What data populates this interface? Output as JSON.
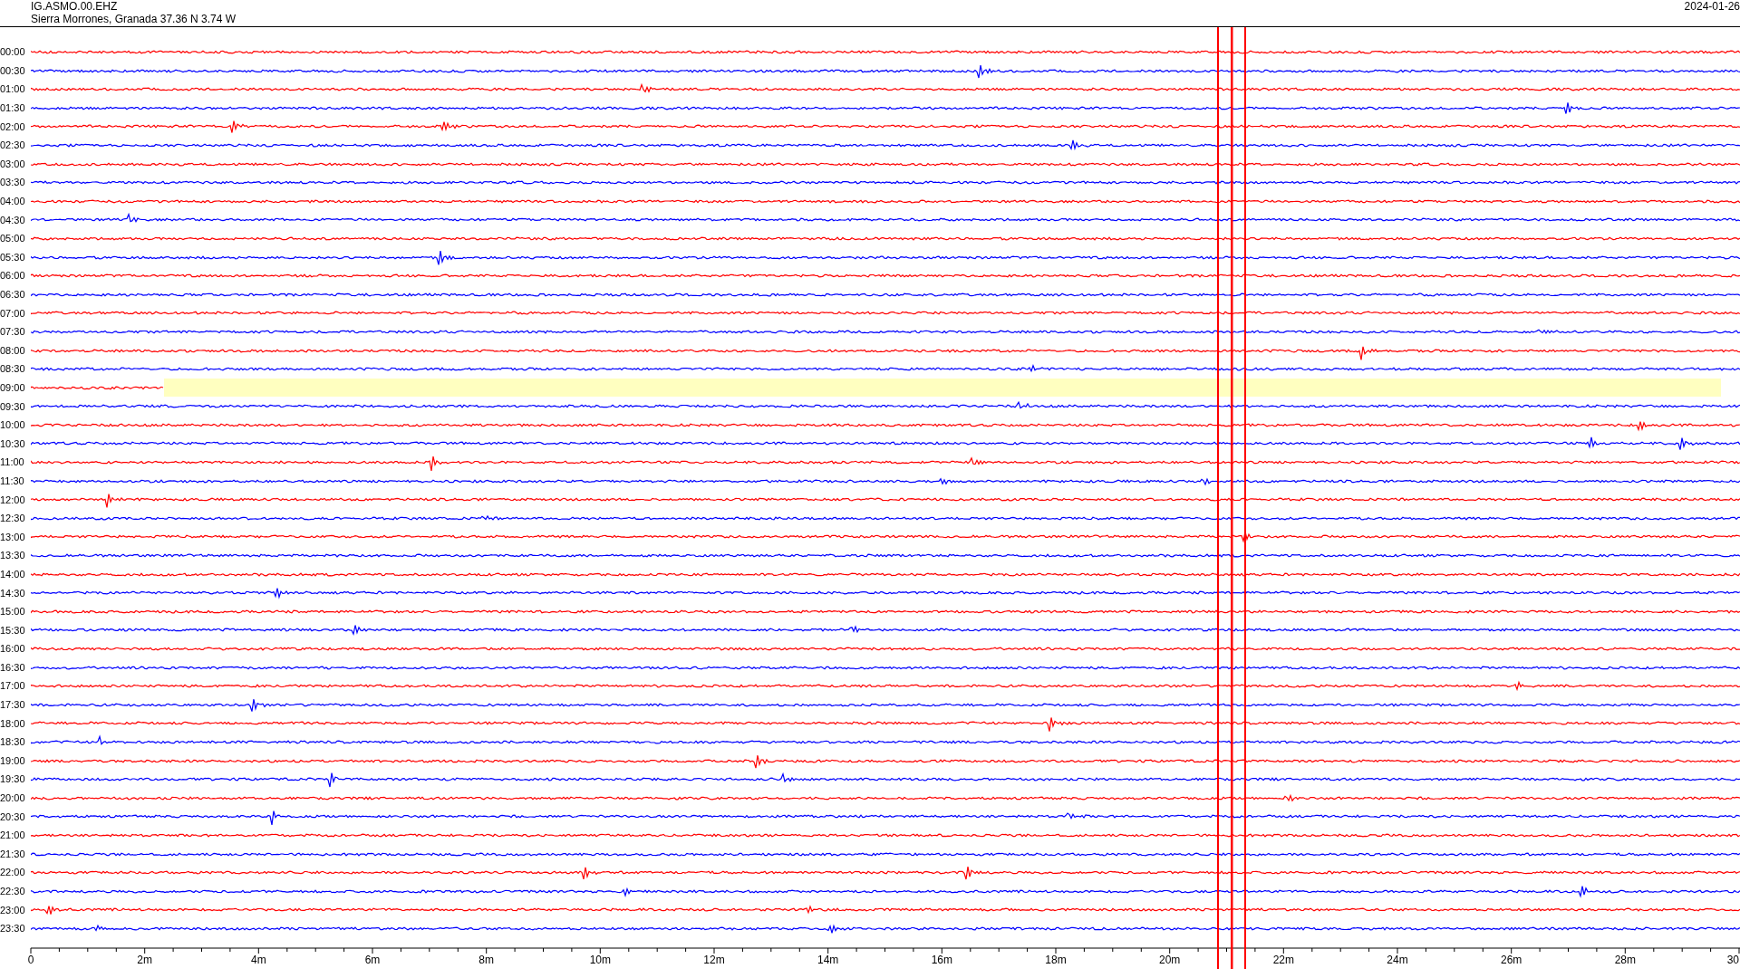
{
  "header": {
    "station": "IG.ASMO.00.EHZ",
    "location": "Sierra Morrones, Granada  37.36 N 3.74 W",
    "date": "2024-01-26"
  },
  "traces": [
    {
      "time": "00:00",
      "color": "#ff0000",
      "marked": false
    },
    {
      "time": "00:30",
      "color": "#0000ff",
      "marked": false
    },
    {
      "time": "01:00",
      "color": "#ff0000",
      "marked": false
    },
    {
      "time": "01:30",
      "color": "#0000ff",
      "marked": false
    },
    {
      "time": "02:00",
      "color": "#ff0000",
      "marked": false
    },
    {
      "time": "02:30",
      "color": "#0000ff",
      "marked": false
    },
    {
      "time": "03:00",
      "color": "#ff0000",
      "marked": false
    },
    {
      "time": "03:30",
      "color": "#0000ff",
      "marked": false
    },
    {
      "time": "04:00",
      "color": "#ff0000",
      "marked": false
    },
    {
      "time": "04:30",
      "color": "#0000ff",
      "marked": false
    },
    {
      "time": "05:00",
      "color": "#ff0000",
      "marked": false
    },
    {
      "time": "05:30",
      "color": "#0000ff",
      "marked": false
    },
    {
      "time": "06:00",
      "color": "#ff0000",
      "marked": false
    },
    {
      "time": "06:30",
      "color": "#0000ff",
      "marked": false
    },
    {
      "time": "07:00",
      "color": "#ff0000",
      "marked": false
    },
    {
      "time": "07:30",
      "color": "#0000ff",
      "marked": false
    },
    {
      "time": "08:00",
      "color": "#ff0000",
      "marked": false
    },
    {
      "time": "08:30",
      "color": "#0000ff",
      "marked": false
    },
    {
      "time": "09:00",
      "color": "#ff0000",
      "marked": true
    },
    {
      "time": "09:30",
      "color": "#0000ff",
      "marked": false
    },
    {
      "time": "10:00",
      "color": "#ff0000",
      "marked": false
    },
    {
      "time": "10:30",
      "color": "#0000ff",
      "marked": false
    },
    {
      "time": "11:00",
      "color": "#ff0000",
      "marked": false
    },
    {
      "time": "11:30",
      "color": "#0000ff",
      "marked": false
    },
    {
      "time": "12:00",
      "color": "#ff0000",
      "marked": false
    },
    {
      "time": "12:30",
      "color": "#0000ff",
      "marked": false
    },
    {
      "time": "13:00",
      "color": "#ff0000",
      "marked": false
    },
    {
      "time": "13:30",
      "color": "#0000ff",
      "marked": false
    },
    {
      "time": "14:00",
      "color": "#ff0000",
      "marked": false
    },
    {
      "time": "14:30",
      "color": "#0000ff",
      "marked": false
    },
    {
      "time": "15:00",
      "color": "#ff0000",
      "marked": false
    },
    {
      "time": "15:30",
      "color": "#0000ff",
      "marked": false
    },
    {
      "time": "16:00",
      "color": "#ff0000",
      "marked": false
    },
    {
      "time": "16:30",
      "color": "#0000ff",
      "marked": false
    },
    {
      "time": "17:00",
      "color": "#ff0000",
      "marked": false
    },
    {
      "time": "17:30",
      "color": "#0000ff",
      "marked": false
    },
    {
      "time": "18:00",
      "color": "#ff0000",
      "marked": false
    },
    {
      "time": "18:30",
      "color": "#0000ff",
      "marked": false
    },
    {
      "time": "19:00",
      "color": "#ff0000",
      "marked": false
    },
    {
      "time": "19:30",
      "color": "#0000ff",
      "marked": false
    },
    {
      "time": "20:00",
      "color": "#ff0000",
      "marked": false
    },
    {
      "time": "20:30",
      "color": "#0000ff",
      "marked": false
    },
    {
      "time": "21:00",
      "color": "#ff0000",
      "marked": false
    },
    {
      "time": "21:30",
      "color": "#0000ff",
      "marked": false
    },
    {
      "time": "22:00",
      "color": "#ff0000",
      "marked": false
    },
    {
      "time": "22:30",
      "color": "#0000ff",
      "marked": false
    },
    {
      "time": "23:00",
      "color": "#ff0000",
      "marked": false
    },
    {
      "time": "23:30",
      "color": "#0000ff",
      "marked": false
    }
  ],
  "x_axis": {
    "labels": [
      "0",
      "2m",
      "4m",
      "6m",
      "8m",
      "10m",
      "12m",
      "14m",
      "16m",
      "18m",
      "20m",
      "22m",
      "24m",
      "26m",
      "28m",
      "30"
    ]
  }
}
